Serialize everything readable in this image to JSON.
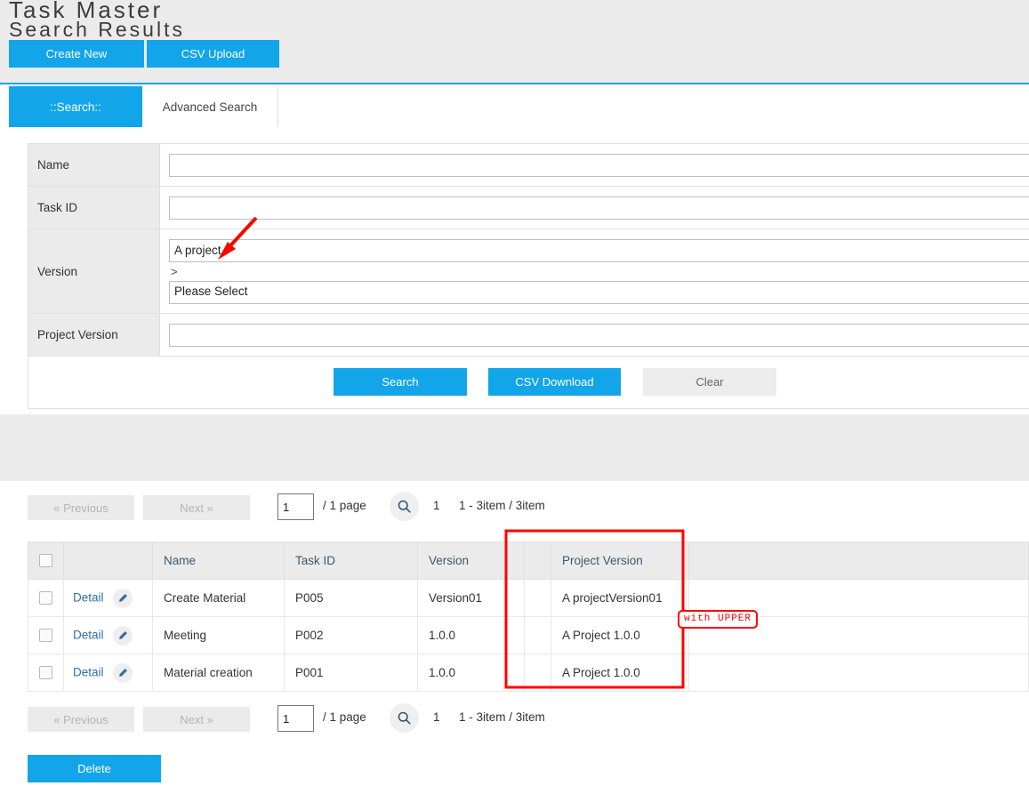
{
  "header": {
    "title": "Task Master",
    "create_new_label": "Create New",
    "csv_upload_label": "CSV Upload"
  },
  "tabs": [
    {
      "label": "::Search::",
      "active": true
    },
    {
      "label": "Advanced Search",
      "active": false
    }
  ],
  "search_form": {
    "rows": [
      {
        "label": "Name",
        "value": "",
        "placeholder": ""
      },
      {
        "label": "Task ID",
        "value": "",
        "placeholder": ""
      },
      {
        "label": "Version",
        "value": "A project",
        "separator": ">",
        "select_value": "Please Select"
      },
      {
        "label": "Project Version",
        "value": "",
        "placeholder": ""
      }
    ],
    "buttons": {
      "search": "Search",
      "csv_download": "CSV Download",
      "clear": "Clear"
    }
  },
  "results": {
    "title": "Search Results",
    "pager": {
      "previous": "«  Previous",
      "next": "Next  »",
      "page_input": "1",
      "of_text": "/  1 page",
      "search_icon": "search-icon",
      "current_page": "1",
      "count_text": "1 - 3item / 3item"
    },
    "columns": [
      "",
      "",
      "Name",
      "Task ID",
      "Version",
      "",
      "Project Version",
      ""
    ],
    "rows": [
      {
        "detail": "Detail",
        "edit_icon": "pencil-icon",
        "name": "Create Material",
        "task_id": "P005",
        "version": "Version01",
        "gap": "",
        "project_version": "A projectVersion01",
        "rest": ""
      },
      {
        "detail": "Detail",
        "edit_icon": "pencil-icon",
        "name": "Meeting",
        "task_id": "P002",
        "version": "1.0.0",
        "gap": "",
        "project_version": "A Project 1.0.0",
        "rest": ""
      },
      {
        "detail": "Detail",
        "edit_icon": "pencil-icon",
        "name": "Material creation",
        "task_id": "P001",
        "version": "1.0.0",
        "gap": "",
        "project_version": "A Project 1.0.0",
        "rest": ""
      }
    ],
    "delete_label": "Delete"
  },
  "annotations": {
    "badge_text": "with UPPER",
    "arrow_color": "#ff0000",
    "highlight_color": "#ff0000"
  },
  "colors": {
    "accent": "#12a5ea",
    "band": "#ebebeb",
    "header_text": "#3c3c3c",
    "table_header_text": "#3a5a72",
    "link": "#2f6fa8"
  }
}
